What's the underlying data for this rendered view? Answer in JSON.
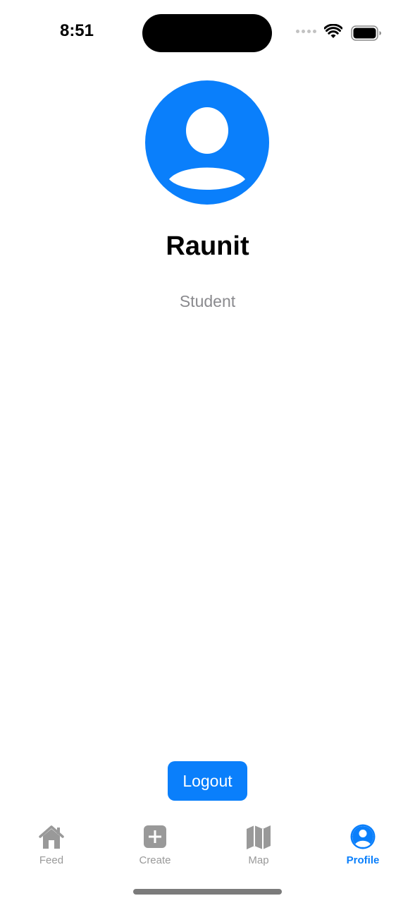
{
  "status_bar": {
    "time": "8:51",
    "icons": [
      "cellular-signal-icon",
      "wifi-icon",
      "battery-icon"
    ]
  },
  "profile": {
    "avatar_icon": "person-circle-icon",
    "name": "Raunit",
    "role": "Student"
  },
  "actions": {
    "logout_label": "Logout"
  },
  "tab_bar": {
    "tabs": [
      {
        "label": "Feed",
        "icon": "house-icon",
        "active": false
      },
      {
        "label": "Create",
        "icon": "plus-square-icon",
        "active": false
      },
      {
        "label": "Map",
        "icon": "map-icon",
        "active": false
      },
      {
        "label": "Profile",
        "icon": "person-circle-icon",
        "active": true
      }
    ]
  },
  "colors": {
    "accent": "#0a7ffb",
    "inactive": "#999999",
    "secondary_text": "#8a8a8e"
  }
}
